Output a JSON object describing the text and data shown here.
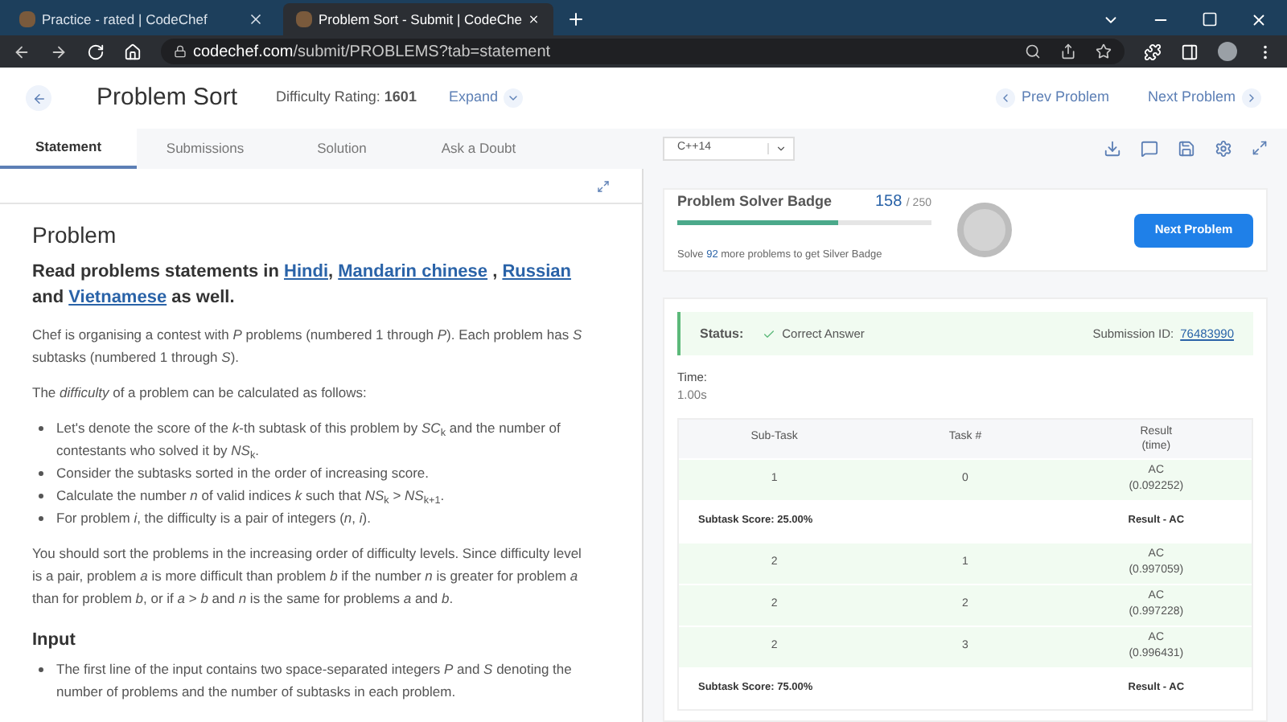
{
  "browser": {
    "tabs": [
      {
        "title": "Practice - rated | CodeChef",
        "selected": false
      },
      {
        "title": "Problem Sort - Submit | CodeChe",
        "selected": true
      }
    ],
    "url_host": "codechef.com",
    "url_path": "/submit/PROBLEMS?tab=statement"
  },
  "header": {
    "title": "Problem Sort",
    "difficulty_label": "Difficulty Rating:",
    "difficulty_value": "1601",
    "expand": "Expand",
    "prev": "Prev Problem",
    "next": "Next Problem"
  },
  "tabs": [
    {
      "label": "Statement",
      "selected": true
    },
    {
      "label": "Submissions",
      "selected": false
    },
    {
      "label": "Solution",
      "selected": false
    },
    {
      "label": "Ask a Doubt",
      "selected": false
    }
  ],
  "language": "C++14",
  "statement": {
    "heading": "Problem",
    "intro": [
      {
        "text": "Read problems statements in ",
        "link": false
      },
      {
        "text": "Hindi",
        "link": true
      },
      {
        "text": ", ",
        "link": false
      },
      {
        "text": "Mandarin chinese",
        "link": true
      },
      {
        "text": " , ",
        "link": false
      },
      {
        "text": "Russian",
        "link": true
      },
      {
        "text": " and ",
        "link": false
      },
      {
        "text": "Vietnamese",
        "link": true
      },
      {
        "text": " as well.",
        "link": false
      }
    ],
    "paragraphs": [
      "Chef is organising a contest with *P* problems (numbered 1 through *P*). Each problem has *S* subtasks (numbered 1 through *S*).",
      "The *difficulty* of a problem can be calculated as follows:"
    ],
    "bullets": [
      "Let's denote the score of the *k*-th subtask of this problem by *SC*$_{k}$ and the number of contestants who solved it by *NS*$_{k}$.",
      "Consider the subtasks sorted in the order of increasing score.",
      "Calculate the number *n* of valid indices *k* such that *NS*$_{k}$ > *NS*$_{k+1}$.",
      "For problem *i*, the difficulty is a pair of integers (*n*, *i*)."
    ],
    "after": "You should sort the problems in the increasing order of difficulty levels. Since difficulty level is a pair, problem *a* is more difficult than problem *b* if the number *n* is greater for problem *a* than for problem *b*, or if *a* > *b* and *n* is the same for problems *a* and *b*.",
    "input_heading": "Input",
    "input_bullets": [
      "The first line of the input contains two space-separated integers *P* and *S* denoting the number of problems and the number of subtasks in each problem."
    ]
  },
  "badge": {
    "title": "Problem Solver Badge",
    "count": "158",
    "total": "/ 250",
    "level": 0.63,
    "hint_pre": "Solve ",
    "hint_num": "92",
    "hint_post": " more problems to get Silver Badge",
    "button": "Next Problem"
  },
  "status": {
    "label": "Status:",
    "value": "Correct Answer",
    "id_label": "Submission ID:",
    "id": "76483990",
    "time_label": "Time:",
    "time": "1.00s"
  },
  "table": {
    "columns": [
      "Sub-Task",
      "Task #",
      "Result",
      "(time)"
    ],
    "rows": [
      {
        "kind": "task",
        "subtask": "1",
        "task": "0",
        "result": "AC",
        "time": "(0.092252)"
      },
      {
        "kind": "score",
        "score": "Subtask Score: 25.00%",
        "result": "Result - AC"
      },
      {
        "kind": "task",
        "subtask": "2",
        "task": "1",
        "result": "AC",
        "time": "(0.997059)"
      },
      {
        "kind": "task",
        "subtask": "2",
        "task": "2",
        "result": "AC",
        "time": "(0.997228)"
      },
      {
        "kind": "task",
        "subtask": "2",
        "task": "3",
        "result": "AC",
        "time": "(0.996431)"
      },
      {
        "kind": "score",
        "score": "Subtask Score: 75.00%",
        "result": "Result - AC"
      }
    ]
  }
}
